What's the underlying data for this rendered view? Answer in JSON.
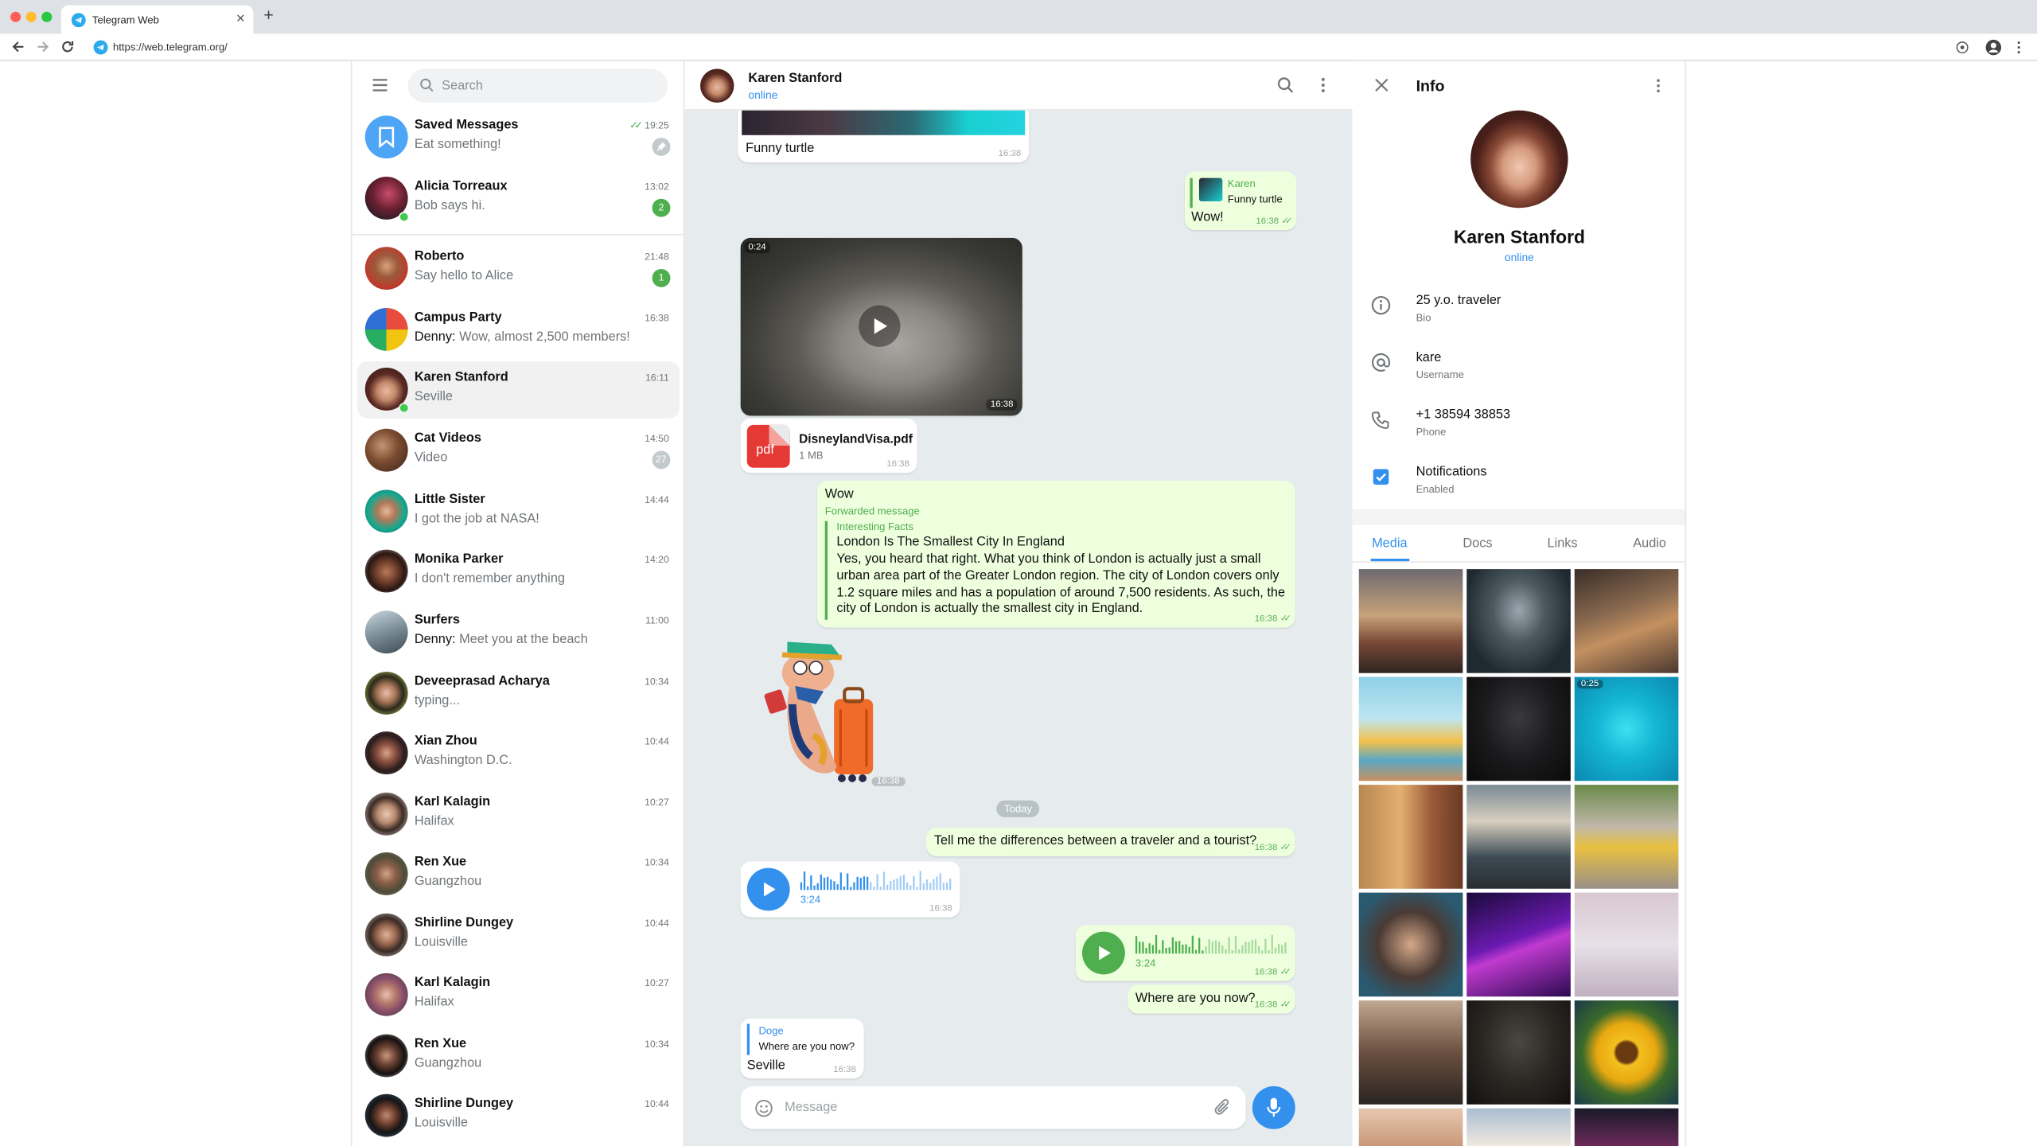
{
  "browser": {
    "tab_title": "Telegram Web",
    "tab_close": "✕",
    "new_tab": "+",
    "url": "https://web.telegram.org/"
  },
  "sidebar": {
    "search_placeholder": "Search",
    "chats": [
      {
        "name": "Saved Messages",
        "sender": "",
        "message": "Eat something!",
        "time": "19:25",
        "badge": "",
        "read": true,
        "pinned": true
      },
      {
        "name": "Alicia Torreaux",
        "sender": "",
        "message": "Bob says hi.",
        "time": "13:02",
        "badge": "2",
        "online": true
      },
      {
        "name": "Roberto",
        "sender": "",
        "message": "Say hello to Alice",
        "time": "21:48",
        "badge": "1"
      },
      {
        "name": "Campus Party",
        "sender": "Denny:",
        "message": " Wow, almost 2,500 members!",
        "time": "16:38",
        "badge": ""
      },
      {
        "name": "Karen Stanford",
        "sender": "",
        "message": "Seville",
        "time": "16:11",
        "badge": "",
        "online": true,
        "active": true
      },
      {
        "name": "Cat Videos",
        "sender": "",
        "message": "Video",
        "time": "14:50",
        "badge": "27",
        "muted": true
      },
      {
        "name": "Little Sister",
        "sender": "",
        "message": "I got the job at NASA!",
        "time": "14:44",
        "badge": ""
      },
      {
        "name": "Monika Parker",
        "sender": "",
        "message": "I don't remember anything",
        "time": "14:20",
        "badge": ""
      },
      {
        "name": "Surfers",
        "sender": "Denny:",
        "message": " Meet you at the beach",
        "time": "11:00",
        "badge": ""
      },
      {
        "name": "Deveeprasad Acharya",
        "sender": "",
        "message": "typing...",
        "time": "10:34",
        "badge": ""
      },
      {
        "name": "Xian Zhou",
        "sender": "",
        "message": "Washington D.C.",
        "time": "10:44",
        "badge": ""
      },
      {
        "name": "Karl Kalagin",
        "sender": "",
        "message": "Halifax",
        "time": "10:27",
        "badge": ""
      },
      {
        "name": "Ren Xue",
        "sender": "",
        "message": "Guangzhou",
        "time": "10:34",
        "badge": ""
      },
      {
        "name": "Shirline Dungey",
        "sender": "",
        "message": "Louisville",
        "time": "10:44",
        "badge": ""
      },
      {
        "name": "Karl Kalagin",
        "sender": "",
        "message": "Halifax",
        "time": "10:27",
        "badge": ""
      },
      {
        "name": "Ren Xue",
        "sender": "",
        "message": "Guangzhou",
        "time": "10:34",
        "badge": ""
      },
      {
        "name": "Shirline Dungey",
        "sender": "",
        "message": "Louisville",
        "time": "10:44",
        "badge": ""
      }
    ]
  },
  "chat": {
    "name": "Karen Stanford",
    "status": "online",
    "messages": {
      "funny_turtle": {
        "text": "Funny turtle",
        "time": "16:38"
      },
      "reply_wow": {
        "reply_author": "Karen",
        "reply_text": "Funny turtle",
        "text": "Wow!",
        "time": "16:38"
      },
      "video": {
        "duration": "0:24",
        "time": "16:38"
      },
      "file": {
        "name": "DisneylandVisa.pdf",
        "size": "1 MB",
        "icon_label": "pdf",
        "time": "16:38"
      },
      "forward": {
        "text": "Wow",
        "label": "Forwarded message",
        "source": "Interesting Facts",
        "title": "London Is The Smallest City In England",
        "body": "Yes, you heard that right. What you think of London is actually just a small urban area part of the Greater London region. The city of London covers only 1.2 square miles and has a population of around 7,500 residents. As such, the city of London is actually the smallest city in England.",
        "time": "16:38"
      },
      "sticker_time": "16:38",
      "date_divider": "Today",
      "question": {
        "text": "Tell me the differences between a traveler and a tourist?",
        "time": "16:38"
      },
      "voice_in": {
        "duration": "3:24",
        "time": "16:38"
      },
      "voice_out": {
        "duration": "3:24",
        "time": "16:38"
      },
      "where": {
        "text": "Where are you now?",
        "time": "16:38"
      },
      "reply_seville": {
        "reply_author": "Doge",
        "reply_text": "Where are you now?",
        "text": "Seville",
        "time": "16:38"
      }
    },
    "composer_placeholder": "Message"
  },
  "info": {
    "title": "Info",
    "name": "Karen Stanford",
    "status": "online",
    "rows": [
      {
        "value": "25 y.o. traveler",
        "label": "Bio",
        "icon": "info-icon"
      },
      {
        "value": "kare",
        "label": "Username",
        "icon": "at-icon"
      },
      {
        "value": "+1 38594 38853",
        "label": "Phone",
        "icon": "phone-icon"
      },
      {
        "value": "Notifications",
        "label": "Enabled",
        "icon": "checkbox-icon"
      }
    ],
    "tabs": [
      "Media",
      "Docs",
      "Links",
      "Audio"
    ],
    "video_duration": "0:25"
  },
  "colors": {
    "accent": "#3390ec",
    "green": "#4fae4e",
    "outgoing": "#eeffde",
    "chat_bg": "#e6ebee"
  }
}
